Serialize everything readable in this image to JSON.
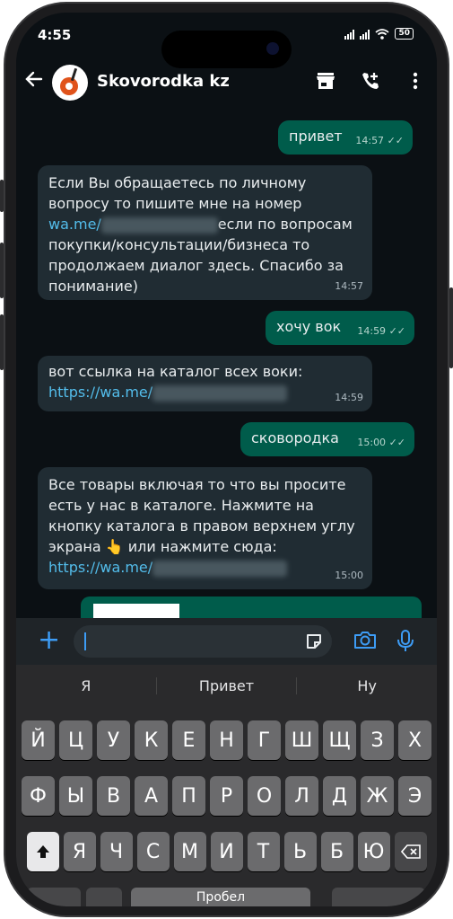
{
  "status": {
    "time": "4:55",
    "battery": "50"
  },
  "header": {
    "contact_name": "Skovorodka kz"
  },
  "messages": [
    {
      "dir": "out",
      "text": "привет",
      "time": "14:57"
    },
    {
      "dir": "in",
      "lines": [
        "Если Вы обращаетесь по личному",
        "вопросу то пишите мне на номер"
      ],
      "link": "wa.me/",
      "link_tail": "если по вопросам",
      "rest": [
        "покупки/консультации/бизнеса то",
        "продолжаем диалог здесь. Спасибо за",
        "понимание)"
      ],
      "time": "14:57"
    },
    {
      "dir": "out",
      "text": "хочу вок",
      "time": "14:59"
    },
    {
      "dir": "in",
      "line1": "вот ссылка на каталог всех  воки:",
      "link": "https://wa.me/",
      "time": "14:59"
    },
    {
      "dir": "out",
      "text": "сковородка",
      "time": "15:00"
    },
    {
      "dir": "in",
      "lines": [
        "Все товары включая то что вы просите",
        "есть у нас в каталоге. Нажмите на",
        "кнопку каталога в правом верхнем углу",
        "экрана 👆 или нажмите сюда:"
      ],
      "link": "https://wa.me/",
      "time": "15:00"
    }
  ],
  "keyboard": {
    "suggestions": [
      "Я",
      "Привет",
      "Ну"
    ],
    "row1": [
      "Й",
      "Ц",
      "У",
      "К",
      "Е",
      "Н",
      "Г",
      "Ш",
      "Щ",
      "З",
      "Х"
    ],
    "row2": [
      "Ф",
      "Ы",
      "В",
      "А",
      "П",
      "Р",
      "О",
      "Л",
      "Д",
      "Ж",
      "Э"
    ],
    "row3": [
      "Я",
      "Ч",
      "С",
      "М",
      "И",
      "Т",
      "Ь",
      "Б",
      "Ю"
    ],
    "space_label": "Пробел"
  },
  "icons": [
    "back-arrow-icon",
    "catalog-store-icon",
    "add-call-icon",
    "more-vert-icon",
    "plus-icon",
    "sticker-icon",
    "camera-icon",
    "mic-icon",
    "shift-icon",
    "backspace-icon"
  ],
  "colors": {
    "outgoing": "#005c4b",
    "incoming": "#202c33",
    "link": "#53bdeb",
    "accent": "#3d9cf5"
  }
}
